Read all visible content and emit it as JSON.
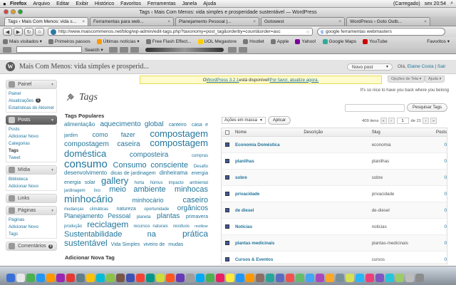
{
  "menubar": {
    "app": "Firefox",
    "items": [
      "Arquivo",
      "Editar",
      "Exibir",
      "Histórico",
      "Favoritos",
      "Ferramentas",
      "Janela",
      "Ajuda"
    ],
    "battery": "(Carregado)",
    "clock": "sex 20:54"
  },
  "window": {
    "title": "Tags ‹ Mais Com Menos: vida simples e prosperidade sustentável — WordPress"
  },
  "tabs": [
    {
      "label": "Tags ‹ Mais Com Menos: vida s..."
    },
    {
      "label": "Ferramentas para web..."
    },
    {
      "label": "Planejamento Pessoal |..."
    },
    {
      "label": "Gotowest"
    },
    {
      "label": "WordPress › Goto Outb..."
    }
  ],
  "nav": {
    "url": "http://www.maiscommenos.net/blog/wp-admin/edit-tags.php?taxonomy=post_tag&orderby=count&order=asc",
    "search": "google ferramentas webmasters"
  },
  "bookmarks": [
    "Mais visitados ▾",
    "Primeiros passos",
    "Últimas notícias ▾",
    "Free Flash Effect...",
    "UOL Megastore",
    "Hootlet",
    "Apple",
    "Yahoo!",
    "Google Maps",
    "YouTube",
    "Favoritos ▾"
  ],
  "addonbar": {
    "search_label": "Search ▾"
  },
  "wp": {
    "site_name": "Mais Com Menos: vida simples e prosperid...",
    "new_post": "Novo post",
    "greeting": "Olá, ",
    "user": "Elaine Costa",
    "separator": " | ",
    "logout": "Sair",
    "update_prefix": "O ",
    "update_link": "WordPress 3.2.1",
    "update_mid": " está disponível! ",
    "update_action": "Por favor, atualize agora.",
    "screen_options": "Opções de Tela ▾",
    "help": "Ajuda ▾",
    "tagline": "It's so nice to have you back where you belong",
    "page_title": "Tags",
    "search_button": "Pesquisar Tags",
    "popular_title": "Tags Populares",
    "add_title": "Adicionar Nova Tag"
  },
  "sidebar": [
    {
      "heading": "Painel",
      "items": [
        "Painel",
        "Atualizações",
        "Estatísticas do Akismet"
      ],
      "badge": "1"
    },
    {
      "heading": "Posts",
      "items": [
        "Posts",
        "Adicionar Novo",
        "Categorias",
        "Tags",
        "Tweet"
      ],
      "current": "Tags"
    },
    {
      "heading": "Mídia",
      "items": [
        "Biblioteca",
        "Adicionar Novo"
      ]
    },
    {
      "heading": "Links",
      "items": []
    },
    {
      "heading": "Páginas",
      "items": [
        "Páginas",
        "Adicionar Novo",
        "Tags"
      ]
    },
    {
      "heading": "Comentários",
      "items": [],
      "badge": "8"
    }
  ],
  "tagcloud": [
    {
      "t": "alimentação",
      "s": 8
    },
    {
      "t": "aquecimento global",
      "s": 10
    },
    {
      "t": "canteiro",
      "s": 7
    },
    {
      "t": "casa e",
      "s": 7
    },
    {
      "t": "jardim",
      "s": 7
    },
    {
      "t": "como fazer",
      "s": 9
    },
    {
      "t": "compostagem",
      "s": 13
    },
    {
      "t": "compostagem caseira",
      "s": 10
    },
    {
      "t": "compostagem",
      "s": 13
    },
    {
      "t": "doméstica",
      "s": 13
    },
    {
      "t": "composteira",
      "s": 10
    },
    {
      "t": "compras",
      "s": 6
    },
    {
      "t": "consumo",
      "s": 15
    },
    {
      "t": "Consumo consciente",
      "s": 11
    },
    {
      "t": "Desafio",
      "s": 6
    },
    {
      "t": "desenvolvimento",
      "s": 8
    },
    {
      "t": "dicas de jardinagem",
      "s": 7
    },
    {
      "t": "dinheirama",
      "s": 8
    },
    {
      "t": "energia",
      "s": 7
    },
    {
      "t": "energia solar",
      "s": 7
    },
    {
      "t": "gallery",
      "s": 13
    },
    {
      "t": "horta",
      "s": 6
    },
    {
      "t": "húmus",
      "s": 6
    },
    {
      "t": "impacto",
      "s": 6
    },
    {
      "t": "ambiental",
      "s": 6
    },
    {
      "t": "jardinagem",
      "s": 6
    },
    {
      "t": "lixo",
      "s": 6
    },
    {
      "t": "meio ambiente",
      "s": 11
    },
    {
      "t": "minhocas",
      "s": 11
    },
    {
      "t": "minhocário",
      "s": 14
    },
    {
      "t": "minhocário",
      "s": 9
    },
    {
      "t": "caseiro",
      "s": 11
    },
    {
      "t": "mudanças climáticas",
      "s": 6
    },
    {
      "t": "natureza",
      "s": 7
    },
    {
      "t": "oportunidade",
      "s": 6
    },
    {
      "t": "orgânicos",
      "s": 10
    },
    {
      "t": "Planejamento Pessoal",
      "s": 9
    },
    {
      "t": "planeta",
      "s": 6
    },
    {
      "t": "plantas",
      "s": 10
    },
    {
      "t": "primavera",
      "s": 7
    },
    {
      "t": "produção",
      "s": 6
    },
    {
      "t": "reciclagem",
      "s": 12
    },
    {
      "t": "recursos naturais",
      "s": 6
    },
    {
      "t": "resíduos",
      "s": 6
    },
    {
      "t": "reutilizar",
      "s": 5
    },
    {
      "t": "Sustentabilidade na",
      "s": 11
    },
    {
      "t": "prática",
      "s": 12
    },
    {
      "t": "sustentável",
      "s": 12
    },
    {
      "t": "Vida Simples",
      "s": 7
    },
    {
      "t": "viveiro de",
      "s": 7
    },
    {
      "t": "mudas",
      "s": 7
    }
  ],
  "table": {
    "bulk_label": "Ações em massa",
    "apply": "Aplicar",
    "count": "409 itens",
    "page": "1",
    "of_pages": "de 21",
    "headers": {
      "name": "Nome",
      "desc": "Descrição",
      "slug": "Slug",
      "posts": "Posts"
    },
    "rows": [
      {
        "name": "Economia Doméstica",
        "slug": "economia",
        "posts": "0"
      },
      {
        "name": "planilhas",
        "slug": "planilhas",
        "posts": "0"
      },
      {
        "name": "sobre",
        "slug": "sobre",
        "posts": "0"
      },
      {
        "name": "privacidade",
        "slug": "privacidade",
        "posts": "0"
      },
      {
        "name": "de diesel",
        "slug": "de-diesel",
        "posts": "0"
      },
      {
        "name": "Notícias",
        "slug": "noticias",
        "posts": "0"
      },
      {
        "name": "plantas medicinais",
        "slug": "plantas-medicinais",
        "posts": "0"
      },
      {
        "name": "Cursos & Eventos",
        "slug": "cursos",
        "posts": "0"
      }
    ]
  },
  "colors": {
    "link": "#21759b",
    "header_bg": "#e4e4e4",
    "nag_bg": "#fffbcc"
  }
}
